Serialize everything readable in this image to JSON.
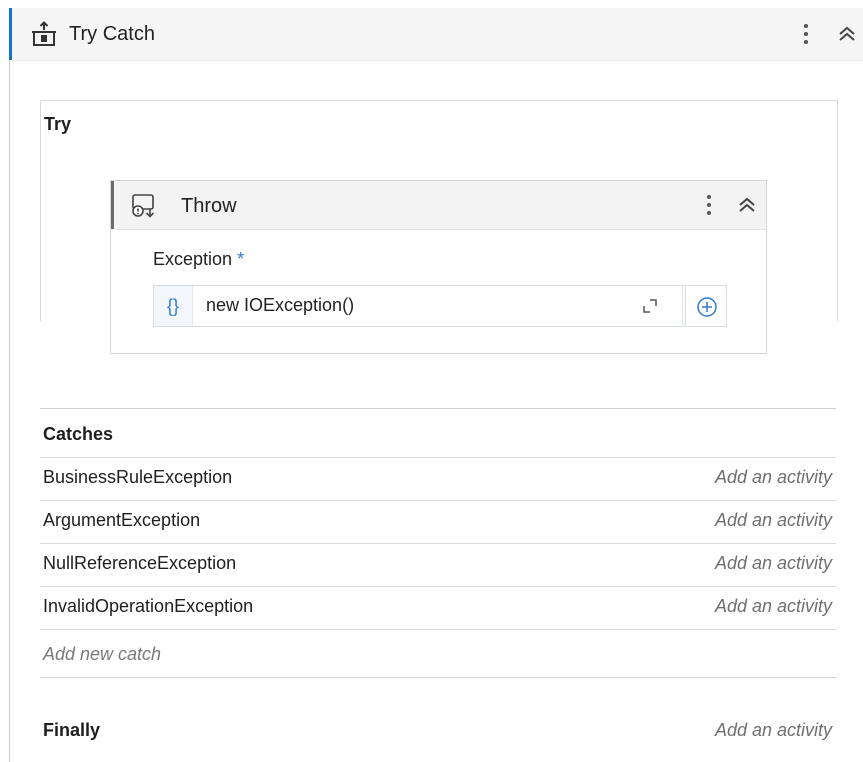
{
  "colors": {
    "accent": "#1a73c8",
    "link_blue": "#2e7bd6",
    "placeholder_gray": "#6f6f6f"
  },
  "try_catch": {
    "icon": "try-catch-icon",
    "title": "Try Catch",
    "more_icon": "kebab-icon",
    "collapse_icon": "double-chevron-up-icon"
  },
  "try_section": {
    "label": "Try",
    "throw_activity": {
      "icon": "throw-icon",
      "title": "Throw",
      "more_icon": "kebab-icon",
      "collapse_icon": "double-chevron-up-icon",
      "exception_label": "Exception",
      "required_marker": "*",
      "expression_prefix": "{}",
      "expression_value": "new IOException()",
      "expand_icon": "expand-icon",
      "add_argument_icon": "plus-circle-icon"
    }
  },
  "catches": {
    "title": "Catches",
    "items": [
      {
        "exception": "BusinessRuleException",
        "action": "Add an activity"
      },
      {
        "exception": "ArgumentException",
        "action": "Add an activity"
      },
      {
        "exception": "NullReferenceException",
        "action": "Add an activity"
      },
      {
        "exception": "InvalidOperationException",
        "action": "Add an activity"
      }
    ],
    "add_new_label": "Add new catch"
  },
  "finally": {
    "title": "Finally",
    "action": "Add an activity"
  }
}
